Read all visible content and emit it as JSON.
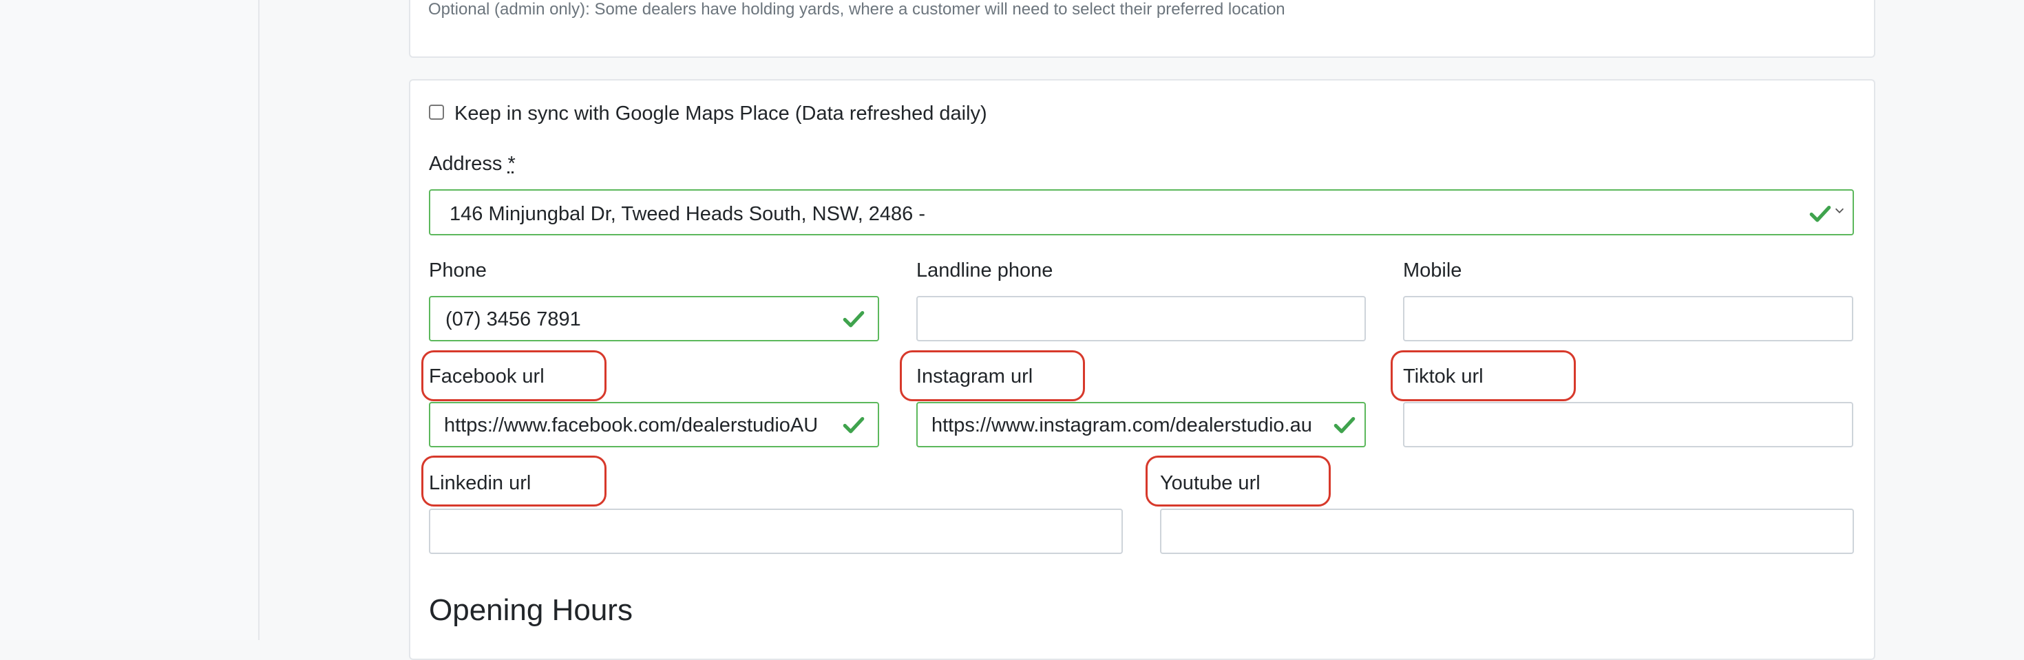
{
  "holding_yards": {
    "help_text": "Optional (admin only): Some dealers have holding yards, where a customer will need to select their preferred location"
  },
  "sync": {
    "label": "Keep in sync with Google Maps Place (Data refreshed daily)",
    "checked": false
  },
  "address": {
    "label": "Address",
    "required_mark": "*",
    "value": "146 Minjungbal Dr, Tweed Heads South, NSW, 2486 -"
  },
  "phone": {
    "label": "Phone",
    "value": "(07) 3456 7891"
  },
  "landline": {
    "label": "Landline phone",
    "value": ""
  },
  "mobile": {
    "label": "Mobile",
    "value": ""
  },
  "facebook": {
    "label": "Facebook url",
    "value": "https://www.facebook.com/dealerstudioAU"
  },
  "instagram": {
    "label": "Instagram url",
    "value": "https://www.instagram.com/dealerstudio.au"
  },
  "tiktok": {
    "label": "Tiktok url",
    "value": ""
  },
  "linkedin": {
    "label": "Linkedin url",
    "value": ""
  },
  "youtube": {
    "label": "Youtube url",
    "value": ""
  },
  "opening_hours": {
    "title": "Opening Hours"
  },
  "colors": {
    "valid_border": "#5cb85c",
    "check_green": "#3fa34d",
    "highlight": "#d7392b"
  },
  "icons": {
    "valid": "check-icon",
    "dropdown": "chevron-down-icon"
  }
}
